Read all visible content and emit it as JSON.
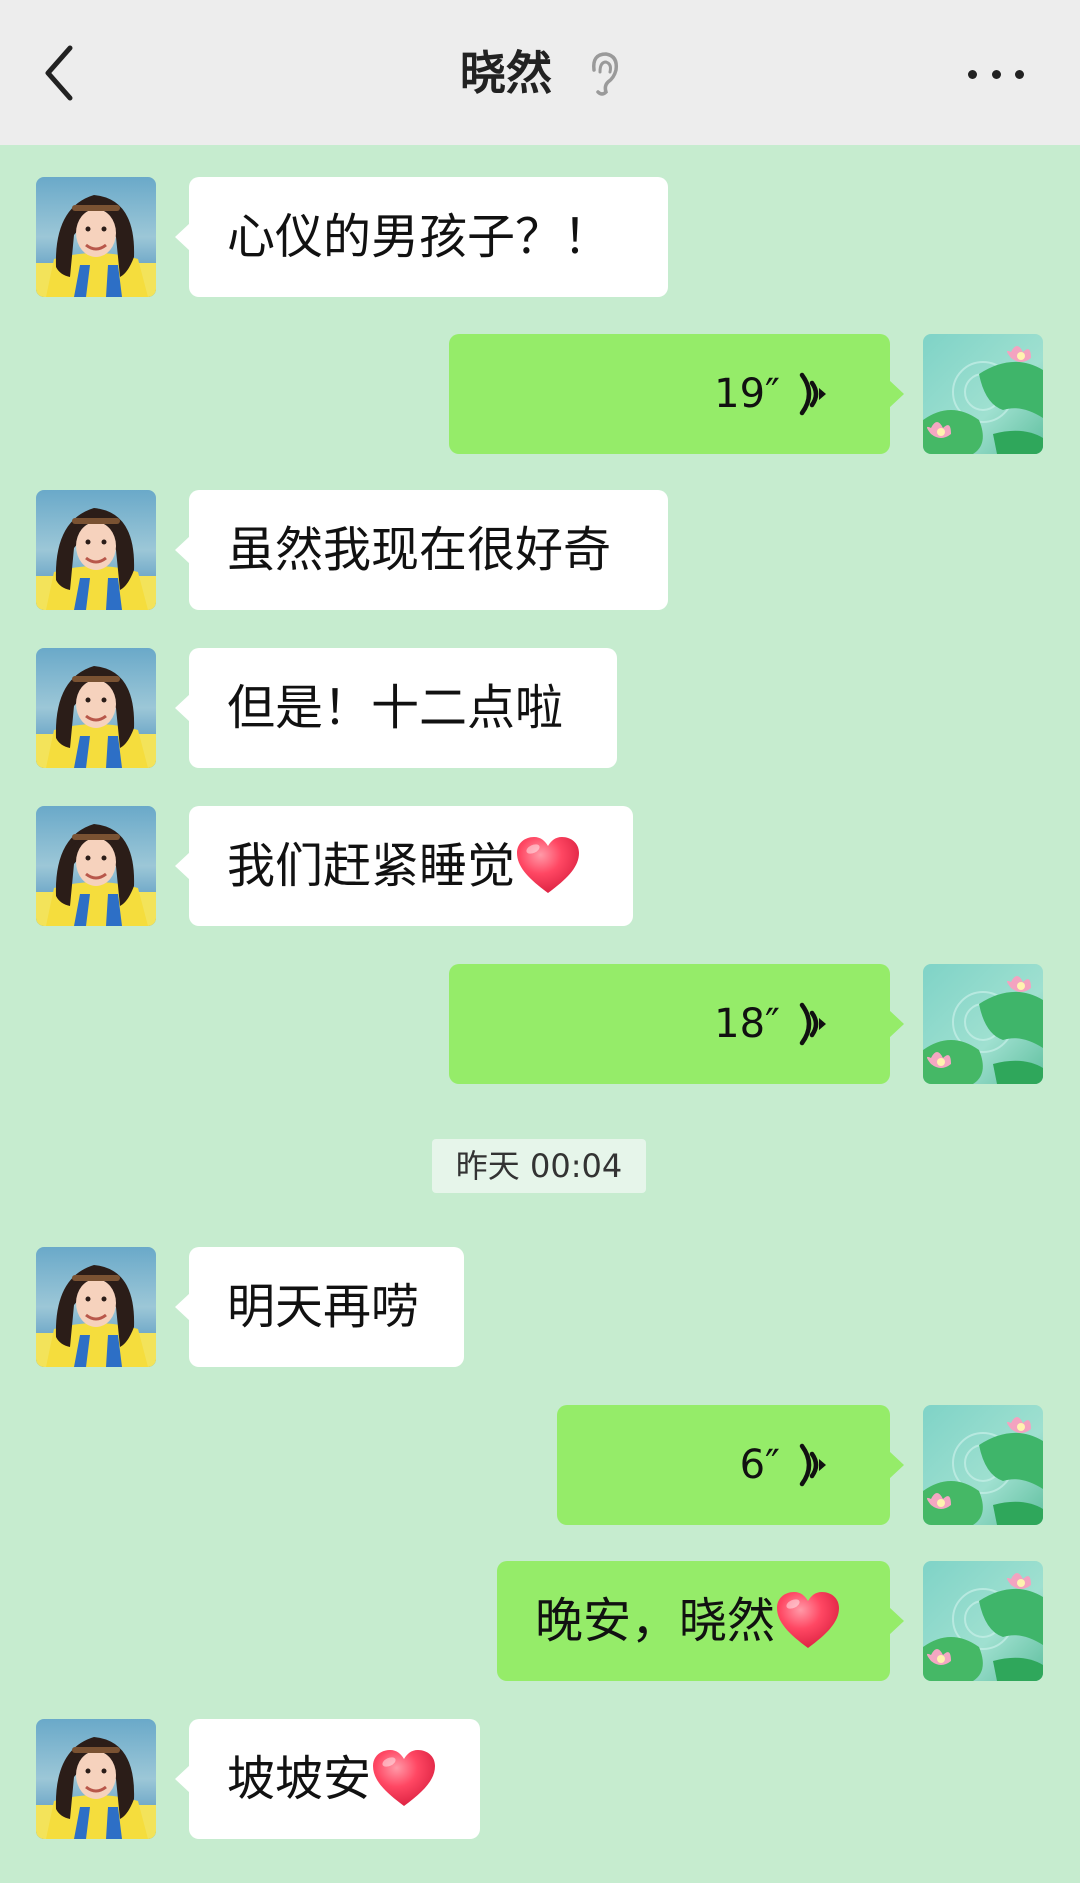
{
  "header": {
    "title": "晓然",
    "back_icon": "chevron-left-icon",
    "mute_icon": "ear-icon",
    "more_icon": "more-dots-icon"
  },
  "colors": {
    "chat_background": "#c6eccf",
    "incoming_bubble": "#ffffff",
    "outgoing_bubble": "#95ec69",
    "header_background": "#ededed"
  },
  "messages": [
    {
      "side": "in",
      "type": "text",
      "text": "心仪的男孩子？！"
    },
    {
      "side": "out",
      "type": "voice",
      "duration": "19″"
    },
    {
      "side": "in",
      "type": "text",
      "text": "虽然我现在很好奇"
    },
    {
      "side": "in",
      "type": "text",
      "text": "但是！十二点啦"
    },
    {
      "side": "in",
      "type": "text",
      "text": "我们赶紧睡觉",
      "emoji": "heart-emoji"
    },
    {
      "side": "out",
      "type": "voice",
      "duration": "18″"
    },
    {
      "side": "in",
      "type": "text",
      "text": "明天再唠"
    },
    {
      "side": "out",
      "type": "voice",
      "duration": "6″"
    },
    {
      "side": "out",
      "type": "text",
      "text": "晚安，晓然",
      "emoji": "heart-emoji"
    },
    {
      "side": "in",
      "type": "text",
      "text": "坡坡安",
      "emoji": "heart-emoji"
    }
  ],
  "timestamp": "昨天 00:04"
}
